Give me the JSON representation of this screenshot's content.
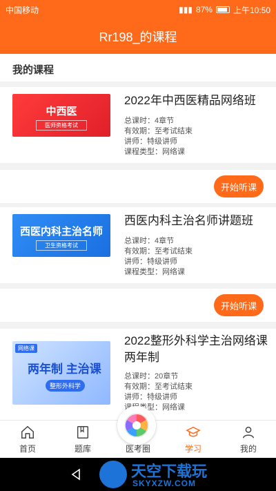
{
  "status": {
    "carrier": "中国移动",
    "battery": "87%",
    "time": "上午10:50"
  },
  "header": {
    "title": "Rr198_的课程"
  },
  "section": {
    "title": "我的课程"
  },
  "courses": [
    {
      "title": "2022年中西医精品网络班",
      "thumb_main": "中西医",
      "thumb_sub": "医师资格考试",
      "hours": "总课时：4章节",
      "validity": "有效期：至考试结束",
      "lecturer": "讲师：特级讲师",
      "type": "课程类型：网络课",
      "button": "开始听课"
    },
    {
      "title": "西医内科主治名师讲题班",
      "thumb_main": "西医内科主治名师",
      "thumb_sub": "卫生资格考试",
      "hours": "总课时：4章节",
      "validity": "有效期：至考试结束",
      "lecturer": "讲师：特级讲师",
      "type": "课程类型：网络课",
      "button": "开始听课"
    },
    {
      "title": "2022整形外科学主治网络课两年制",
      "thumb_main": "两年制 主治课",
      "thumb_sub": "整形外科学",
      "thumb_tag": "网络课",
      "hours": "总课时：20章节",
      "validity": "有效期：至考试结束",
      "lecturer": "讲师：特级讲师",
      "type": "课程类型：网络课"
    }
  ],
  "nav": {
    "items": [
      {
        "label": "首页",
        "icon": "home-icon"
      },
      {
        "label": "题库",
        "icon": "book-icon"
      },
      {
        "label": "医考圈",
        "icon": "circle-icon"
      },
      {
        "label": "学习",
        "icon": "graduation-cap-icon"
      },
      {
        "label": "我的",
        "icon": "user-icon"
      }
    ]
  },
  "watermark": {
    "cn": "天空下载玩",
    "en": "SKYXZW.COM"
  },
  "colors": {
    "brand": "#ff6a1a"
  }
}
